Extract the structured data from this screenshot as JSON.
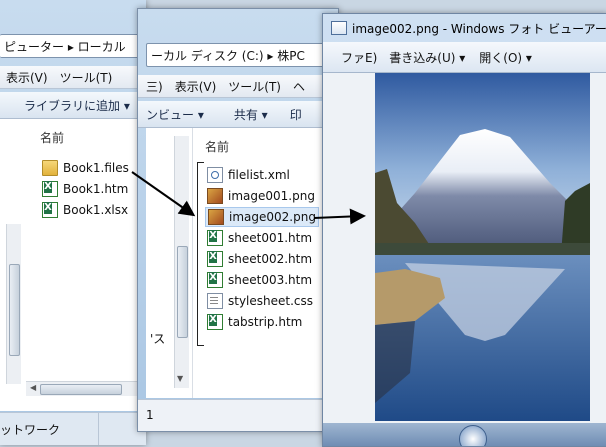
{
  "left_window": {
    "breadcrumb": "ピューター ▸ ローカル",
    "menu": [
      "表示(V)",
      "ツール(T)"
    ],
    "toolbar_library": "ライブラリに追加 ▾",
    "column_name": "名前",
    "files": [
      {
        "name": "Book1.files",
        "icon": "folder-icon"
      },
      {
        "name": "Book1.htm",
        "icon": "excel-html-icon"
      },
      {
        "name": "Book1.xlsx",
        "icon": "excel-icon"
      }
    ],
    "status_network": "ットワーク"
  },
  "middle_window": {
    "breadcrumb": "ーカル ディスク (C:) ▸ 株PC",
    "menu_partial": "三)",
    "menu": [
      "表示(V)",
      "ツール(T)",
      "ヘ"
    ],
    "toolbar_preview": "ンビュー ▾",
    "toolbar_share": "共有 ▾",
    "toolbar_print": "印",
    "column_name": "名前",
    "nav_partial": "'ス",
    "status_count": "1",
    "files": [
      {
        "name": "filelist.xml",
        "icon": "xml-icon"
      },
      {
        "name": "image001.png",
        "icon": "image-icon"
      },
      {
        "name": "image002.png",
        "icon": "image-icon",
        "selected": true
      },
      {
        "name": "sheet001.htm",
        "icon": "excel-html-icon"
      },
      {
        "name": "sheet002.htm",
        "icon": "excel-html-icon"
      },
      {
        "name": "sheet003.htm",
        "icon": "excel-html-icon"
      },
      {
        "name": "stylesheet.css",
        "icon": "css-icon"
      },
      {
        "name": "tabstrip.htm",
        "icon": "excel-html-icon"
      }
    ]
  },
  "photo_viewer": {
    "title": "image002.png - Windows フォト ビューアー",
    "menu_file": "ファ",
    "menu_file_suffix": "E)",
    "menu_write": "書き込み(U) ▾",
    "menu_open": "開く(O) ▾"
  },
  "colors": {
    "sky_top": "#3a64a8",
    "sky_bottom": "#bcd1ea",
    "lake": "#2f5a93",
    "accent_blue": "#1b2c4a"
  }
}
